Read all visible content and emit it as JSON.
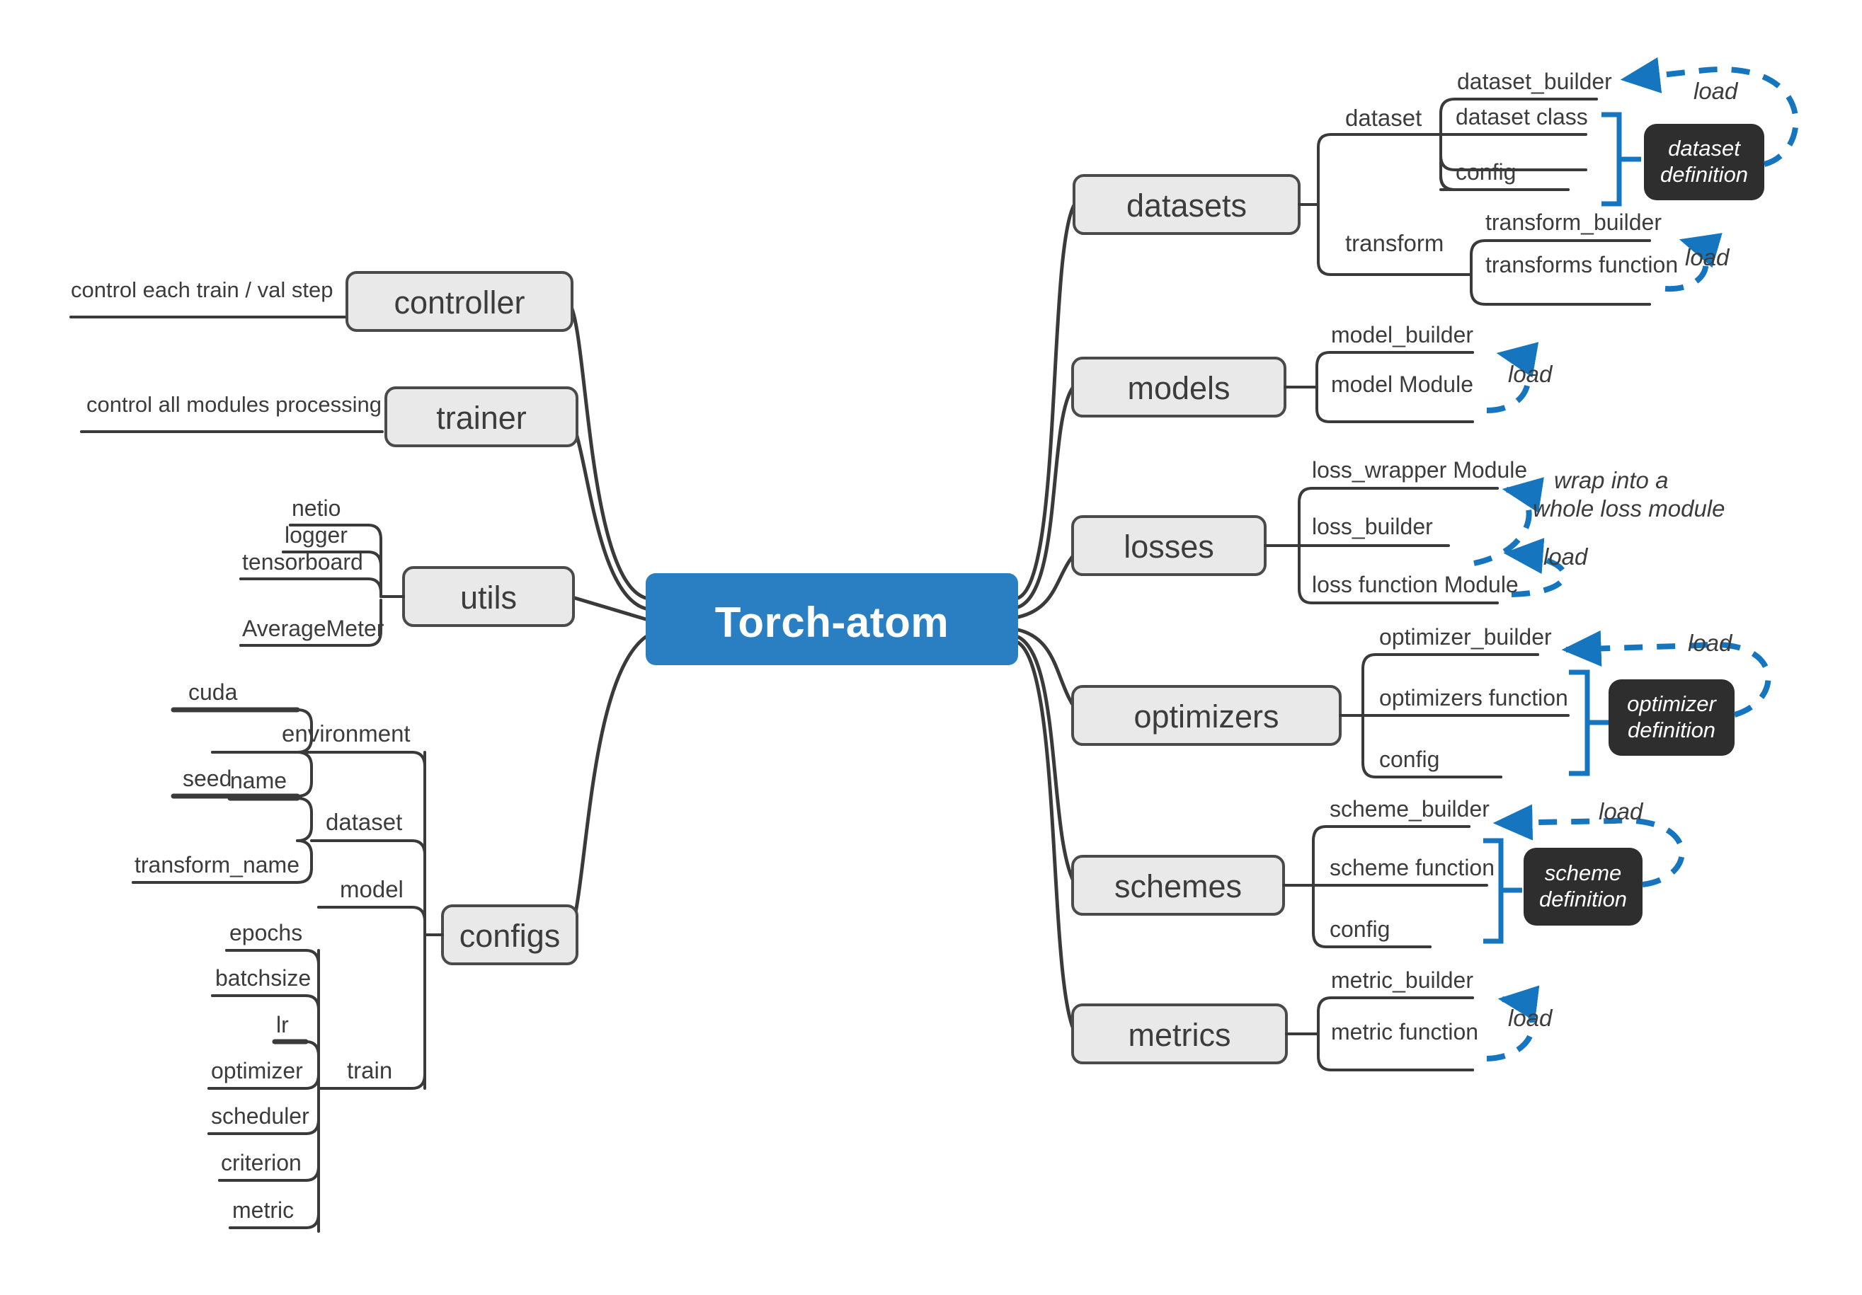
{
  "title": "Torch-atom",
  "colors": {
    "center_fill": "#2a7fc3",
    "center_text": "#ffffff",
    "node_fill": "#e9e9e9",
    "node_stroke": "#4a4a4a",
    "line": "#3a3a3a",
    "accent_blue": "#1576bf",
    "definition_fill": "#2e2e2e",
    "definition_text": "#ffffff",
    "text": "#3c3c3c",
    "background": "#ffffff"
  },
  "center": {
    "label": "Torch-atom"
  },
  "left_branches": [
    {
      "id": "controller",
      "label": "controller",
      "note": "control each train / val step"
    },
    {
      "id": "trainer",
      "label": "trainer",
      "note": "control all modules processing"
    },
    {
      "id": "utils",
      "label": "utils",
      "children": [
        "netio",
        "logger",
        "tensorboard",
        "AverageMeter"
      ]
    },
    {
      "id": "configs",
      "label": "configs",
      "groups": [
        {
          "label": "environment",
          "children": [
            "cuda",
            "seed"
          ]
        },
        {
          "label": "dataset",
          "children": [
            "name",
            "transform_name"
          ]
        },
        {
          "label": "model",
          "children": []
        },
        {
          "label": "train",
          "children": [
            "epochs",
            "batchsize",
            "lr",
            "optimizer",
            "scheduler",
            "criterion",
            "metric"
          ]
        }
      ]
    }
  ],
  "right_branches": [
    {
      "id": "datasets",
      "label": "datasets",
      "groups": [
        {
          "label": "dataset",
          "children": [
            "dataset_builder",
            "dataset class",
            "config"
          ],
          "definition": "dataset\ndefinition",
          "bracket": true,
          "load_label": "load"
        },
        {
          "label": "transform",
          "children": [
            "transform_builder",
            "transforms function"
          ],
          "definition": null,
          "bracket": false,
          "load_label": "load"
        }
      ]
    },
    {
      "id": "models",
      "label": "models",
      "groups": [
        {
          "label": null,
          "children": [
            "model_builder",
            "model Module"
          ],
          "definition": null,
          "bracket": false,
          "load_label": "load"
        }
      ]
    },
    {
      "id": "losses",
      "label": "losses",
      "groups": [
        {
          "label": null,
          "children": [
            "loss_wrapper Module",
            "loss_builder",
            "loss function Module"
          ],
          "definition": null,
          "bracket": false,
          "load_label": "load",
          "wrap_label_line1": "wrap into a",
          "wrap_label_line2": "whole loss module"
        }
      ]
    },
    {
      "id": "optimizers",
      "label": "optimizers",
      "groups": [
        {
          "label": null,
          "children": [
            "optimizer_builder",
            "optimizers function",
            "config"
          ],
          "definition": "optimizer\ndefinition",
          "bracket": true,
          "load_label": "load"
        }
      ]
    },
    {
      "id": "schemes",
      "label": "schemes",
      "groups": [
        {
          "label": null,
          "children": [
            "scheme_builder",
            "scheme function",
            "config"
          ],
          "definition": "scheme\ndefinition",
          "bracket": true,
          "load_label": "load"
        }
      ]
    },
    {
      "id": "metrics",
      "label": "metrics",
      "groups": [
        {
          "label": null,
          "children": [
            "metric_builder",
            "metric function"
          ],
          "definition": null,
          "bracket": false,
          "load_label": "load"
        }
      ]
    }
  ]
}
